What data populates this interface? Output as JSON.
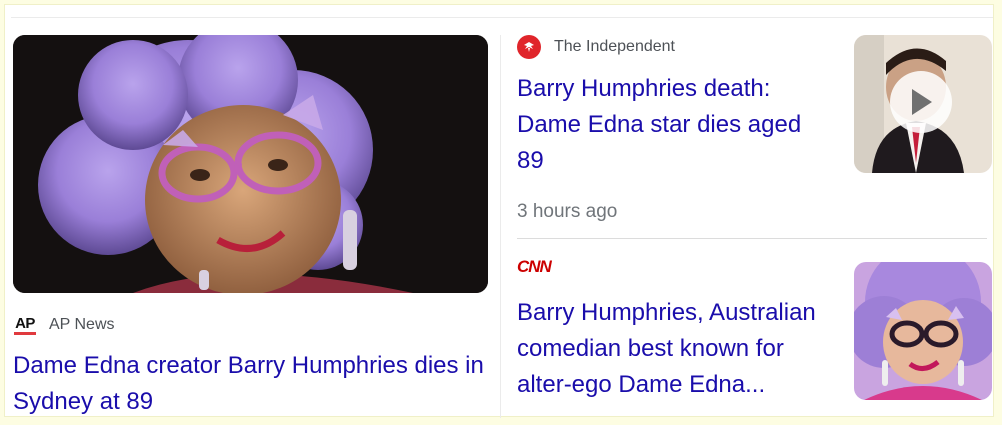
{
  "stories": [
    {
      "source": "AP News",
      "logo_text": "AP",
      "headline": "Dame Edna creator Barry Humphries dies in Sydney at 89",
      "image": "portrait-purple-hair-photo"
    },
    {
      "source": "The Independent",
      "logo_icon": "eagle-icon",
      "headline": "Barry Humphries death: Dame Edna star dies aged 89",
      "time": "3 hours ago",
      "image": "man-in-suit-video-thumbnail",
      "has_video": true
    },
    {
      "source": "CNN",
      "logo_text": "CNN",
      "headline": "Barry Humphries, Australian comedian best known for alter-ego Dame Edna...",
      "image": "portrait-purple-hair-thumbnail"
    }
  ],
  "colors": {
    "headline": "#1a0dab",
    "meta": "#70757a",
    "source": "#4d5156",
    "independent_red": "#e0252b",
    "cnn_red": "#cc0000",
    "ap_red": "#e03a3e",
    "hair_purple": "#9a7fd8",
    "page_background": "#fdfde2"
  }
}
